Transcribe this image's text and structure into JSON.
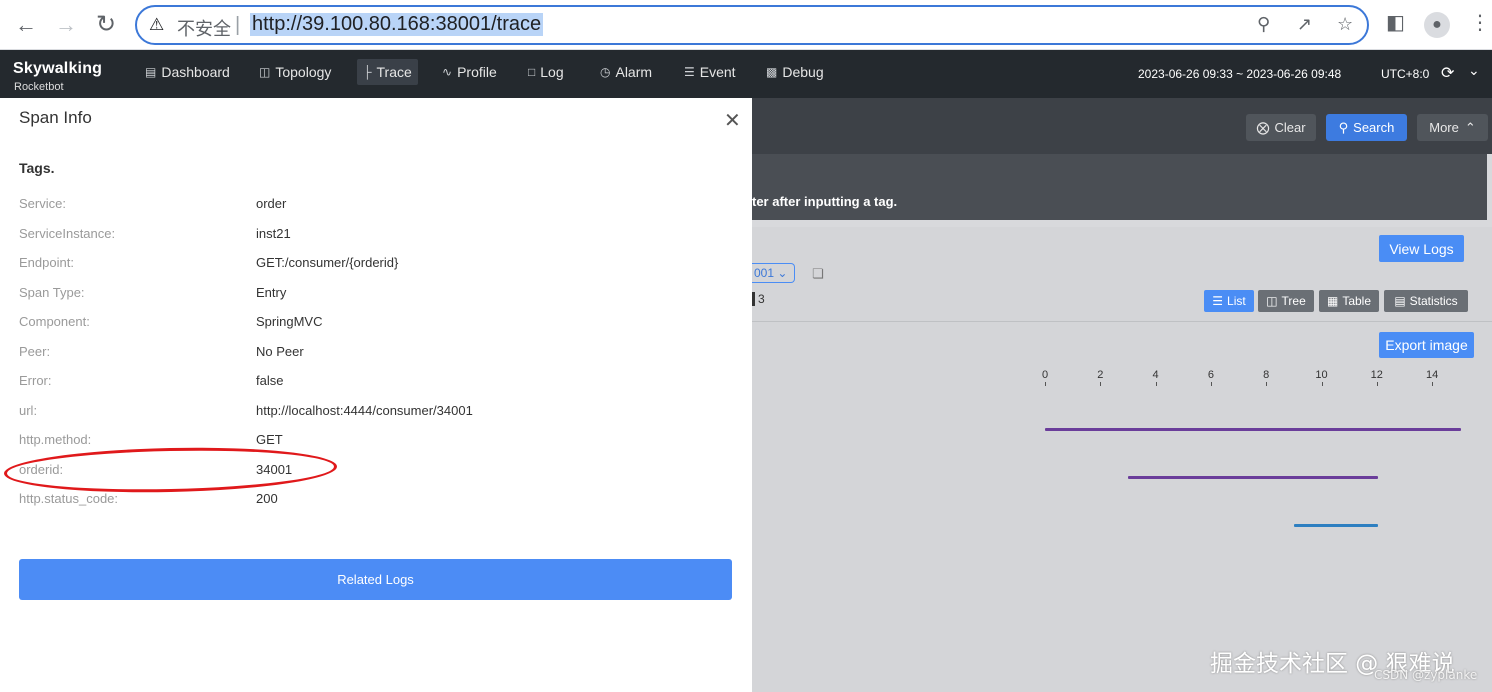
{
  "browser": {
    "insecure_label": "不安全",
    "separator": "|",
    "url": "http://39.100.80.168:38001/trace",
    "icons": [
      "back-arrow-icon",
      "forward-arrow-icon",
      "reload-icon",
      "warning-icon",
      "zoom-icon",
      "share-icon",
      "star-icon",
      "sidepanel-icon",
      "profile-icon",
      "kebab-menu-icon"
    ]
  },
  "app": {
    "logo": "Skywalking",
    "logo_sub": "Rocketbot",
    "nav": [
      {
        "label": "Dashboard",
        "icon": "dashboard-icon"
      },
      {
        "label": "Topology",
        "icon": "topology-icon"
      },
      {
        "label": "Trace",
        "icon": "trace-icon",
        "active": true
      },
      {
        "label": "Profile",
        "icon": "profile-chart-icon"
      },
      {
        "label": "Log",
        "icon": "log-icon"
      },
      {
        "label": "Alarm",
        "icon": "alarm-icon"
      },
      {
        "label": "Event",
        "icon": "event-icon"
      },
      {
        "label": "Debug",
        "icon": "debug-icon"
      }
    ],
    "time_range": "2023-06-26 09:33 ~ 2023-06-26 09:48",
    "timezone": "UTC+8:0"
  },
  "toolbar": {
    "clear_label": "Clear",
    "search_label": "Search",
    "more_label": "More",
    "tip_text": "ter after inputting a tag."
  },
  "trace_detail": {
    "view_logs_label": "View Logs",
    "trace_id_fragment": "001",
    "span_count": "3",
    "views": [
      {
        "label": "List",
        "icon": "list-icon",
        "active": true
      },
      {
        "label": "Tree",
        "icon": "tree-icon"
      },
      {
        "label": "Table",
        "icon": "table-icon"
      },
      {
        "label": "Statistics",
        "icon": "statistics-icon"
      }
    ],
    "export_label": "Export image",
    "axis_ticks": [
      "0",
      "2",
      "4",
      "6",
      "8",
      "10",
      "12",
      "14"
    ],
    "span_colors": [
      "#6a3d9a",
      "#6a3d9a",
      "#2d7fc1"
    ]
  },
  "span_info": {
    "title": "Span Info",
    "tags_title": "Tags.",
    "tags": [
      {
        "key": "Service:",
        "value": "order"
      },
      {
        "key": "ServiceInstance:",
        "value": "inst21"
      },
      {
        "key": "Endpoint:",
        "value": "GET:/consumer/{orderid}"
      },
      {
        "key": "Span Type:",
        "value": "Entry"
      },
      {
        "key": "Component:",
        "value": "SpringMVC"
      },
      {
        "key": "Peer:",
        "value": "No Peer"
      },
      {
        "key": "Error:",
        "value": "false"
      },
      {
        "key": "url:",
        "value": "http://localhost:4444/consumer/34001"
      },
      {
        "key": "http.method:",
        "value": "GET"
      },
      {
        "key": "orderid:",
        "value": "34001"
      },
      {
        "key": "http.status_code:",
        "value": "200"
      }
    ],
    "related_logs_label": "Related Logs"
  },
  "watermark": {
    "main": "掘金技术社区 @ 狠难说",
    "sub": "CSDN @zyplanke"
  }
}
